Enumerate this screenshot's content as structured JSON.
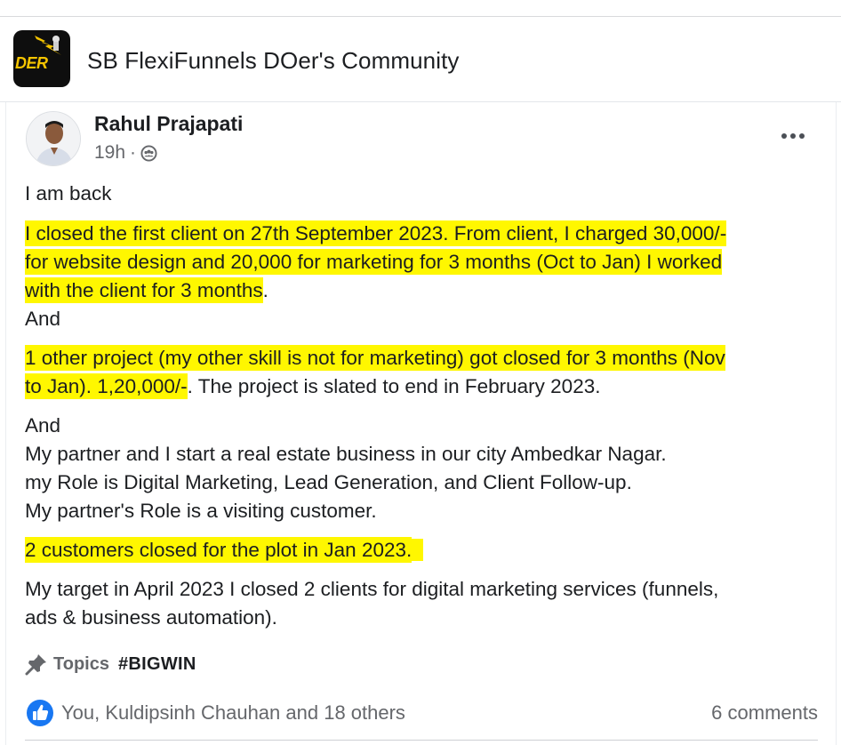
{
  "group": {
    "name": "SB FlexiFunnels DOer's Community",
    "avatar_text": "DER"
  },
  "post": {
    "author": "Rahul Prajapati",
    "time": "19h",
    "meta_separator": "·",
    "audience_icon": "group-audience-icon",
    "paragraphs": {
      "p1": "I am back",
      "p2_line1": "I closed the first client on 27th September 2023. From client, I charged 30,000/-",
      "p2_line2": "for website design and 20,000 for marketing for 3 months (Oct to Jan) I worked",
      "p2_line3_hl": "with the client for 3 months",
      "p2_line3_rest": ".",
      "p3": "And",
      "p4_line1": "1 other project (my other skill is not for marketing) got closed for 3 months (Nov",
      "p4_line2_hl": "to Jan). 1,20,000/-",
      "p4_line2_rest": ". The project is slated to end in February 2023.",
      "p5_line1": "And",
      "p5_line2": "My partner and I start a real estate business in our city Ambedkar Nagar.",
      "p5_line3": "my Role is Digital Marketing, Lead Generation, and Client Follow-up.",
      "p5_line4": "My partner's Role is a visiting customer.",
      "p6": "2 customers closed for the plot in Jan 2023.",
      "p7_line1": "My target in April 2023 I closed 2 clients for digital marketing services (funnels,",
      "p7_line2": "ads & business automation)."
    },
    "topics_label": "Topics",
    "topic_tag": "#BIGWIN",
    "reactions_text": "You, Kuldipsinh Chauhan and 18 others",
    "comments_text": "6 comments"
  },
  "colors": {
    "highlight": "#fff700",
    "secondary_text": "#65676b",
    "like_blue": "#1877f2"
  },
  "icons": [
    "pin-icon",
    "like-icon",
    "more-options-icon",
    "group-audience-icon"
  ]
}
